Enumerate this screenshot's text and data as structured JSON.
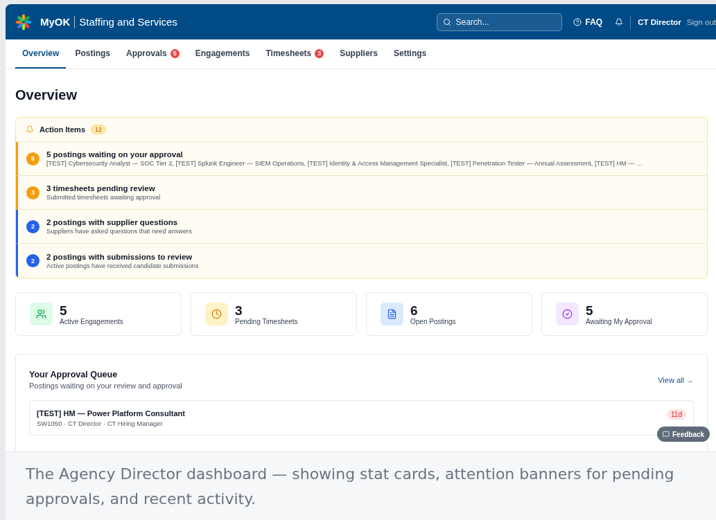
{
  "header": {
    "brand": "MyOK",
    "product": "Staffing and Services",
    "search": {
      "placeholder": "Search..."
    },
    "faq": "FAQ",
    "user": "CT Director",
    "sign_out": "Sign out"
  },
  "tabs": [
    {
      "label": "Overview",
      "selected": true
    },
    {
      "label": "Postings",
      "selected": false
    },
    {
      "label": "Approvals",
      "badge": "5",
      "selected": false
    },
    {
      "label": "Engagements",
      "selected": false
    },
    {
      "label": "Timesheets",
      "badge": "3",
      "selected": false
    },
    {
      "label": "Suppliers",
      "selected": false
    },
    {
      "label": "Settings",
      "selected": false
    }
  ],
  "page_title": "Overview",
  "action_items": {
    "title": "Action Items",
    "count": "12",
    "items": [
      {
        "count": "5",
        "title": "5 postings waiting on your approval",
        "subtitle": "[TEST] Cybersecurity Analyst — SOC Tier 2, [TEST] Splunk Engineer — SIEM Operations, [TEST] Identity & Access Management Specialist, [TEST] Penetration Tester — Annual Assessment, [TEST] HM — …",
        "color": "#f59e0b"
      },
      {
        "count": "3",
        "title": "3 timesheets pending review",
        "subtitle": "Submitted timesheets awaiting approval",
        "color": "#f59e0b"
      },
      {
        "count": "2",
        "title": "2 postings with supplier questions",
        "subtitle": "Suppliers have asked questions that need answers",
        "color": "#2563eb"
      },
      {
        "count": "2",
        "title": "2 postings with submissions to review",
        "subtitle": "Active postings have received candidate submissions",
        "color": "#2563eb"
      }
    ]
  },
  "stats": [
    {
      "kind": "users",
      "value": "5",
      "label": "Active Engagements"
    },
    {
      "kind": "clock",
      "value": "3",
      "label": "Pending Timesheets"
    },
    {
      "kind": "document",
      "value": "6",
      "label": "Open Postings"
    },
    {
      "kind": "check",
      "value": "5",
      "label": "Awaiting My Approval"
    }
  ],
  "approval_queue": {
    "title": "Your Approval Queue",
    "subtitle": "Postings waiting on your review and approval",
    "link": "View all →",
    "rows": [
      {
        "title": "[TEST] HM — Power Platform Consultant",
        "meta": "SW1050 · CT Director · CT Hiring Manager",
        "age": "11d"
      }
    ]
  },
  "feedback": "Feedback",
  "caption": "The Agency Director dashboard — showing stat cards, attention banners for pending approvals, and recent activity."
}
